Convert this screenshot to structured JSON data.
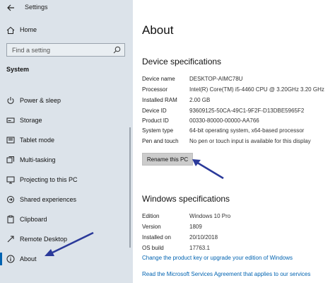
{
  "window": {
    "title": "Settings"
  },
  "sidebar": {
    "home_label": "Home",
    "search_placeholder": "Find a setting",
    "section_label": "System",
    "items": [
      {
        "label": "Power & sleep",
        "icon": "power-icon"
      },
      {
        "label": "Storage",
        "icon": "storage-icon"
      },
      {
        "label": "Tablet mode",
        "icon": "tablet-mode-icon"
      },
      {
        "label": "Multi-tasking",
        "icon": "multitasking-icon"
      },
      {
        "label": "Projecting to this PC",
        "icon": "projecting-icon"
      },
      {
        "label": "Shared experiences",
        "icon": "shared-experiences-icon"
      },
      {
        "label": "Clipboard",
        "icon": "clipboard-icon"
      },
      {
        "label": "Remote Desktop",
        "icon": "remote-desktop-icon"
      },
      {
        "label": "About",
        "icon": "info-icon",
        "selected": true
      }
    ]
  },
  "main": {
    "title": "About",
    "device_specs": {
      "heading": "Device specifications",
      "rows": [
        {
          "key": "Device name",
          "value": "DESKTOP-AIMC78U"
        },
        {
          "key": "Processor",
          "value": "Intel(R) Core(TM) i5-4460  CPU @ 3.20GHz   3.20 GHz"
        },
        {
          "key": "Installed RAM",
          "value": "2.00 GB"
        },
        {
          "key": "Device ID",
          "value": "93609125-50CA-49C1-9F2F-D13DBE5965F2"
        },
        {
          "key": "Product ID",
          "value": "00330-80000-00000-AA766"
        },
        {
          "key": "System type",
          "value": "64-bit operating system, x64-based processor"
        },
        {
          "key": "Pen and touch",
          "value": "No pen or touch input is available for this display"
        }
      ],
      "rename_button": "Rename this PC"
    },
    "windows_specs": {
      "heading": "Windows specifications",
      "rows": [
        {
          "key": "Edition",
          "value": "Windows 10 Pro"
        },
        {
          "key": "Version",
          "value": "1809"
        },
        {
          "key": "Installed on",
          "value": "20/10/2018"
        },
        {
          "key": "OS build",
          "value": "17763.1"
        }
      ],
      "link_product_key": "Change the product key or upgrade your edition of Windows",
      "link_services": "Read the Microsoft Services Agreement that applies to our services"
    }
  },
  "colors": {
    "accent": "#0063b1",
    "sidebar_bg": "#dce3ea",
    "annotation_arrow": "#2b3a9a"
  }
}
